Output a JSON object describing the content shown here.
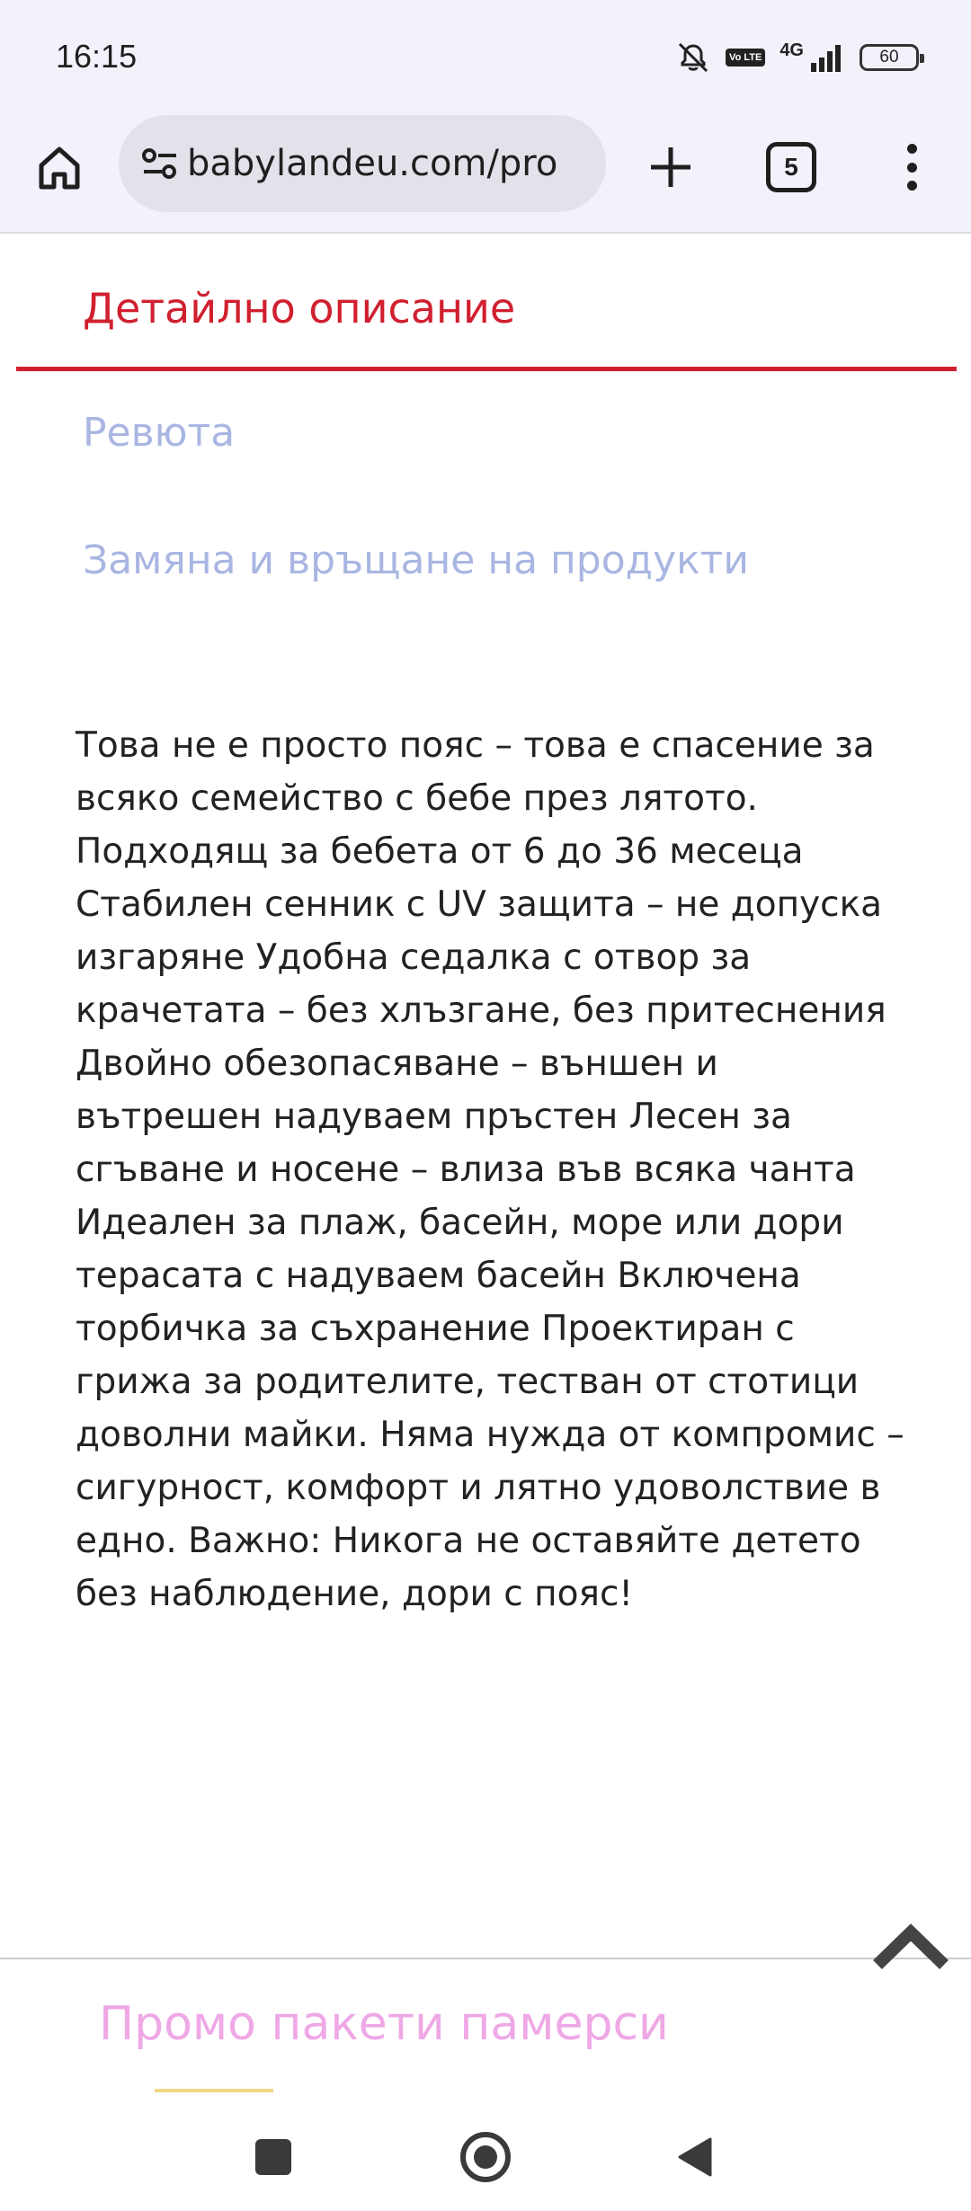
{
  "status_bar": {
    "time": "16:15",
    "network": "4G",
    "volte": "Vo LTE",
    "battery": "60",
    "icons": [
      "mute-icon",
      "volte-icon",
      "signal-icon",
      "battery-icon"
    ]
  },
  "browser": {
    "url": "babylandeu.com/pro",
    "tab_count": "5",
    "icons": [
      "home-icon",
      "site-settings-icon",
      "new-tab-icon",
      "tabs-icon",
      "overflow-menu-icon"
    ]
  },
  "page": {
    "tabs": [
      {
        "label": "Детайлно описание",
        "active": true
      },
      {
        "label": "Ревюта",
        "active": false
      },
      {
        "label": "Замяна и връщане на продукти",
        "active": false
      }
    ],
    "description": "Това не е просто пояс – това е спасение за всяко семейство с бебе през лятото. Подходящ за бебета от 6 до 36 месеца Стабилен сенник с UV защита – не допуска изгаряне Удобна седалка с отвор за крачетата – без хлъзгане, без притеснения Двойно обезопасяване – външен и вътрешен надуваем пръстен Лесен за сгъване и носене – влиза във всяка чанта Идеален за плаж, басейн, море или дори терасата с надуваем басейн Включена торбичка за съхранение Проектиран с грижа за родителите, тестван от стотици доволни майки. Няма нужда от компромис – сигурност, комфорт и лятно удоволствие в едно. Важно: Никога не оставяйте детето без наблюдение, дори с пояс!",
    "promo_heading": "Промо пакети памерси"
  },
  "colors": {
    "accent": "#d0202f",
    "inactive_tab": "#a9b6e2",
    "promo": "#efa8e6",
    "chrome_bg": "#f1f2fa"
  },
  "nav_bar": {
    "icons": [
      "recents-icon",
      "home-circle-icon",
      "back-icon"
    ]
  }
}
